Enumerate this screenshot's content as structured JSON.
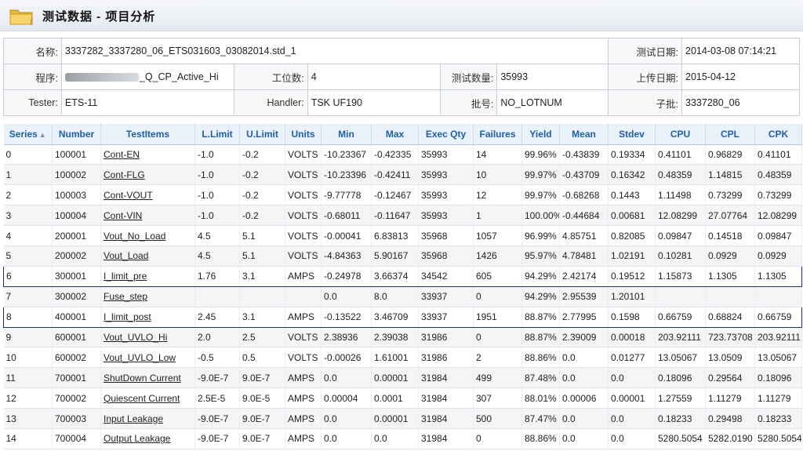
{
  "window": {
    "title": "测试数据 - 项目分析"
  },
  "colors": {
    "header_text": "#1f5fa8",
    "header_bg": "#e9f1fb",
    "selected_border": "#1f2f7a"
  },
  "info": {
    "name_label": "名称:",
    "name_value": "3337282_3337280_06_ETS031603_03082014.std_1",
    "test_date_label": "测试日期:",
    "test_date_value": "2014-03-08 07:14:21",
    "program_label": "程序:",
    "program_value": "_Q_CP_Active_Hi",
    "station_label": "工位数:",
    "station_value": "4",
    "test_count_label": "测试数量:",
    "test_count_value": "35993",
    "upload_date_label": "上传日期:",
    "upload_date_value": "2015-04-12",
    "tester_label": "Tester:",
    "tester_value": "ETS-11",
    "handler_label": "Handler:",
    "handler_value": "TSK UF190",
    "lot_label": "批号:",
    "lot_value": "NO_LOTNUM",
    "sublot_label": "子批:",
    "sublot_value": "3337280_06"
  },
  "grid": {
    "columns": [
      "Series",
      "Number",
      "TestItems",
      "L.Limit",
      "U.Limit",
      "Units",
      "Min",
      "Max",
      "Exec Qty",
      "Failures",
      "Yield",
      "Mean",
      "Stdev",
      "CPU",
      "CPL",
      "CPK"
    ],
    "rows": [
      [
        "0",
        "100001",
        "Cont-EN",
        "-1.0",
        "-0.2",
        "VOLTS",
        "-10.23367",
        "-0.42335",
        "35993",
        "14",
        "99.96%",
        "-0.43839",
        "0.19334",
        "0.41101",
        "0.96829",
        "0.41101"
      ],
      [
        "1",
        "100002",
        "Cont-FLG",
        "-1.0",
        "-0.2",
        "VOLTS",
        "-10.23396",
        "-0.42411",
        "35993",
        "10",
        "99.97%",
        "-0.43709",
        "0.16342",
        "0.48359",
        "1.14815",
        "0.48359"
      ],
      [
        "2",
        "100003",
        "Cont-VOUT",
        "-1.0",
        "-0.2",
        "VOLTS",
        "-9.77778",
        "-0.12467",
        "35993",
        "12",
        "99.97%",
        "-0.68268",
        "0.1443",
        "1.11498",
        "0.73299",
        "0.73299"
      ],
      [
        "3",
        "100004",
        "Cont-VIN",
        "-1.0",
        "-0.2",
        "VOLTS",
        "-0.68011",
        "-0.11647",
        "35993",
        "1",
        "100.00%",
        "-0.44684",
        "0.00681",
        "12.08299",
        "27.07764",
        "12.08299"
      ],
      [
        "4",
        "200001",
        "Vout_No_Load",
        "4.5",
        "5.1",
        "VOLTS",
        "-0.00041",
        "6.83813",
        "35968",
        "1057",
        "96.99%",
        "4.85751",
        "0.82085",
        "0.09847",
        "0.14518",
        "0.09847"
      ],
      [
        "5",
        "200002",
        "Vout_Load",
        "4.5",
        "5.1",
        "VOLTS",
        "-4.84363",
        "5.90167",
        "35968",
        "1426",
        "95.97%",
        "4.78481",
        "1.02191",
        "0.10281",
        "0.0929",
        "0.0929"
      ],
      [
        "6",
        "300001",
        "I_limit_pre",
        "1.76",
        "3.1",
        "AMPS",
        "-0.24978",
        "3.66374",
        "34542",
        "605",
        "94.29%",
        "2.42174",
        "0.19512",
        "1.15873",
        "1.1305",
        "1.1305"
      ],
      [
        "7",
        "300002",
        "Fuse_step",
        "",
        "",
        "",
        "0.0",
        "8.0",
        "33937",
        "0",
        "94.29%",
        "2.95539",
        "1.20101",
        "",
        "",
        ""
      ],
      [
        "8",
        "400001",
        "I_limit_post",
        "2.45",
        "3.1",
        "AMPS",
        "-0.13522",
        "3.46709",
        "33937",
        "1951",
        "88.87%",
        "2.77995",
        "0.1598",
        "0.66759",
        "0.68824",
        "0.66759"
      ],
      [
        "9",
        "600001",
        "Vout_UVLO_Hi",
        "2.0",
        "2.5",
        "VOLTS",
        "2.38936",
        "2.39038",
        "31986",
        "0",
        "88.87%",
        "2.39009",
        "0.00018",
        "203.92111",
        "723.73708",
        "203.92111"
      ],
      [
        "10",
        "600002",
        "Vout_UVLO_Low",
        "-0.5",
        "0.5",
        "VOLTS",
        "-0.00026",
        "1.61001",
        "31986",
        "2",
        "88.86%",
        "0.0",
        "0.01277",
        "13.05067",
        "13.0509",
        "13.05067"
      ],
      [
        "11",
        "700001",
        "ShutDown Current",
        "-9.0E-7",
        "9.0E-7",
        "AMPS",
        "0.0",
        "0.00001",
        "31984",
        "499",
        "87.48%",
        "0.0",
        "0.0",
        "0.18096",
        "0.29564",
        "0.18096"
      ],
      [
        "12",
        "700002",
        "Quiescent Current",
        "2.5E-5",
        "9.0E-5",
        "AMPS",
        "0.00004",
        "0.0001",
        "31984",
        "307",
        "88.01%",
        "0.00006",
        "0.00001",
        "1.27559",
        "1.11279",
        "1.11279"
      ],
      [
        "13",
        "700003",
        "Input Leakage",
        "-9.0E-7",
        "9.0E-7",
        "AMPS",
        "0.0",
        "0.00001",
        "31984",
        "500",
        "87.47%",
        "0.0",
        "0.0",
        "0.18233",
        "0.29498",
        "0.18233"
      ],
      [
        "14",
        "700004",
        "Output Leakage",
        "-9.0E-7",
        "9.0E-7",
        "AMPS",
        "0.0",
        "0.0",
        "31984",
        "0",
        "88.86%",
        "0.0",
        "0.0",
        "5280.5054",
        "5282.0190",
        "5280.5054"
      ]
    ],
    "selected_rows": [
      6,
      8
    ],
    "sort_indicator": "▲"
  }
}
